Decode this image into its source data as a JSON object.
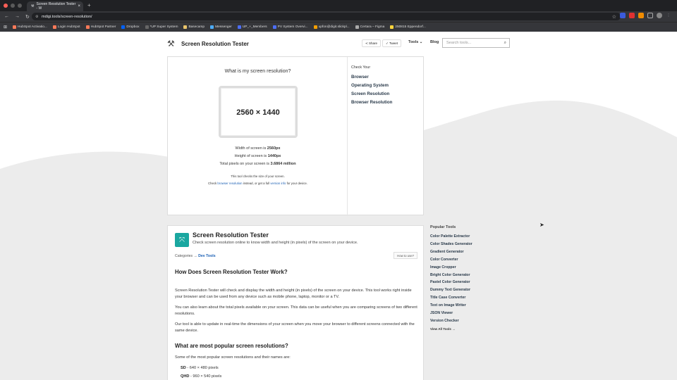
{
  "browser": {
    "tab_title": "Screen Resolution Tester - W",
    "url": "mdigi.tools/screen-resolution/",
    "bookmarks": [
      "HubSpot Activatio...",
      "Login HubSpot",
      "HubSpot Partner",
      "Dropbox",
      "*UP Super System",
      "Basecamp",
      "Messenger",
      "UP_+_Members",
      "PV System Overvi...",
      "upfon@digit.slickpl...",
      "Certara – Figma",
      "250815 Eppendorf..."
    ]
  },
  "header": {
    "site_title": "Screen Resolution Tester",
    "share_label": "Share",
    "tweet_label": "Tweet",
    "tools_label": "Tools",
    "blog_label": "Blog",
    "search_placeholder": "Search tools..."
  },
  "result": {
    "question": "What is my screen resolution?",
    "resolution": "2560 × 1440",
    "width_prefix": "Width of screen is ",
    "width_value": "2560px",
    "height_prefix": "Height of screen is ",
    "height_value": "1440px",
    "total_prefix": "Total pixels on your screen is ",
    "total_value": "3.6864 million",
    "note1": "This tool checks the size of your screen.",
    "note2_a": "Check ",
    "note2_link1": "browser resolution",
    "note2_b": " instead, or get a full ",
    "note2_link2": "version info",
    "note2_c": " for your device."
  },
  "check_your": {
    "title": "Check Your",
    "items": [
      "Browser",
      "Operating System",
      "Screen Resolution",
      "Browser Resolution"
    ]
  },
  "tool": {
    "title": "Screen Resolution Tester",
    "description": "Check screen resolution online to know width and height (in pixels) of the screen on your device.",
    "categories_label": "Categories →",
    "category": "Dev Tools",
    "howto_label": "How to use?",
    "h_how": "How Does Screen Resolution Tester Work?",
    "p1": "Screen Resolution Tester will check and display the width and height (in pixels) of the screen on your device. This tool works right inside your browser and can be used from any device such as mobile phone, laptop, monitor or a TV.",
    "p2": "You can also learn about the total pixels available on your screen. This data can be useful when you are comparing screens of two different resolutions.",
    "p3": "Our tool is able to update in real-time the dimensions of your screen when you move your browser to different screens connected with the same device.",
    "h_popular": "What are most popular screen resolutions?",
    "p4": "Some of the most popular screen resolutions and their names are:",
    "res_list": [
      {
        "name": "SD",
        "value": " - 640 × 480 pixels"
      },
      {
        "name": "QHD",
        "value": " - 960 × 540 pixels"
      }
    ]
  },
  "popular_tools": {
    "title": "Popular Tools",
    "items": [
      "Color Palette Extractor",
      "Color Shades Generator",
      "Gradient Generator",
      "Color Converter",
      "Image Cropper",
      "Bright Color Generator",
      "Pastel Color Generator",
      "Dummy Text Generator",
      "Title Case Converter",
      "Text on Image Writer",
      "JSON Viewer",
      "Version Checker"
    ],
    "view_all": "View All Tools →"
  },
  "colors": {
    "accent_teal": "#1aa7a0",
    "link_blue": "#1a5fb4"
  }
}
